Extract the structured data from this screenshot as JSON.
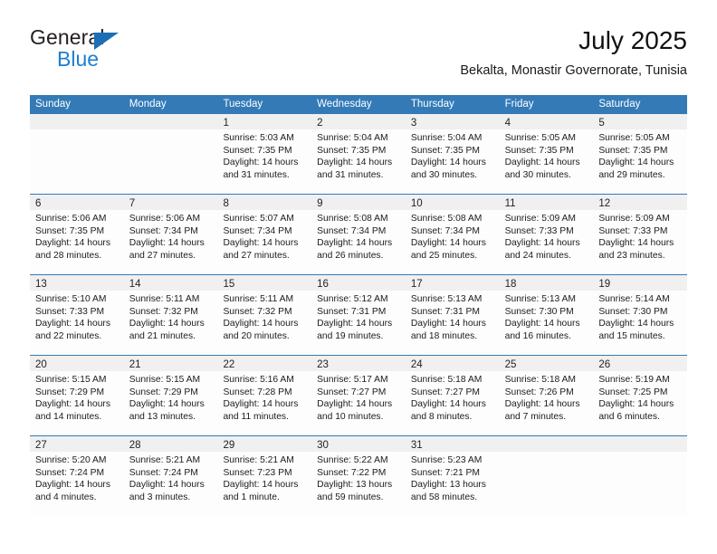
{
  "brand": {
    "name_part1": "General",
    "name_part2": "Blue",
    "accent_color": "#1c7fd3",
    "triangle_color": "#1c6fb5"
  },
  "header": {
    "title": "July 2025",
    "subtitle": "Bekalta, Monastir Governorate, Tunisia"
  },
  "theme": {
    "header_row_color": "#337ab7",
    "day_band_color": "#f0f0f0",
    "row_separator_color": "#337ab7"
  },
  "weekdays": [
    "Sunday",
    "Monday",
    "Tuesday",
    "Wednesday",
    "Thursday",
    "Friday",
    "Saturday"
  ],
  "weeks": [
    [
      {
        "day": "",
        "sunrise": "",
        "sunset": "",
        "daylight_line1": "",
        "daylight_line2": ""
      },
      {
        "day": "",
        "sunrise": "",
        "sunset": "",
        "daylight_line1": "",
        "daylight_line2": ""
      },
      {
        "day": "1",
        "sunrise": "Sunrise: 5:03 AM",
        "sunset": "Sunset: 7:35 PM",
        "daylight_line1": "Daylight: 14 hours",
        "daylight_line2": "and 31 minutes."
      },
      {
        "day": "2",
        "sunrise": "Sunrise: 5:04 AM",
        "sunset": "Sunset: 7:35 PM",
        "daylight_line1": "Daylight: 14 hours",
        "daylight_line2": "and 31 minutes."
      },
      {
        "day": "3",
        "sunrise": "Sunrise: 5:04 AM",
        "sunset": "Sunset: 7:35 PM",
        "daylight_line1": "Daylight: 14 hours",
        "daylight_line2": "and 30 minutes."
      },
      {
        "day": "4",
        "sunrise": "Sunrise: 5:05 AM",
        "sunset": "Sunset: 7:35 PM",
        "daylight_line1": "Daylight: 14 hours",
        "daylight_line2": "and 30 minutes."
      },
      {
        "day": "5",
        "sunrise": "Sunrise: 5:05 AM",
        "sunset": "Sunset: 7:35 PM",
        "daylight_line1": "Daylight: 14 hours",
        "daylight_line2": "and 29 minutes."
      }
    ],
    [
      {
        "day": "6",
        "sunrise": "Sunrise: 5:06 AM",
        "sunset": "Sunset: 7:35 PM",
        "daylight_line1": "Daylight: 14 hours",
        "daylight_line2": "and 28 minutes."
      },
      {
        "day": "7",
        "sunrise": "Sunrise: 5:06 AM",
        "sunset": "Sunset: 7:34 PM",
        "daylight_line1": "Daylight: 14 hours",
        "daylight_line2": "and 27 minutes."
      },
      {
        "day": "8",
        "sunrise": "Sunrise: 5:07 AM",
        "sunset": "Sunset: 7:34 PM",
        "daylight_line1": "Daylight: 14 hours",
        "daylight_line2": "and 27 minutes."
      },
      {
        "day": "9",
        "sunrise": "Sunrise: 5:08 AM",
        "sunset": "Sunset: 7:34 PM",
        "daylight_line1": "Daylight: 14 hours",
        "daylight_line2": "and 26 minutes."
      },
      {
        "day": "10",
        "sunrise": "Sunrise: 5:08 AM",
        "sunset": "Sunset: 7:34 PM",
        "daylight_line1": "Daylight: 14 hours",
        "daylight_line2": "and 25 minutes."
      },
      {
        "day": "11",
        "sunrise": "Sunrise: 5:09 AM",
        "sunset": "Sunset: 7:33 PM",
        "daylight_line1": "Daylight: 14 hours",
        "daylight_line2": "and 24 minutes."
      },
      {
        "day": "12",
        "sunrise": "Sunrise: 5:09 AM",
        "sunset": "Sunset: 7:33 PM",
        "daylight_line1": "Daylight: 14 hours",
        "daylight_line2": "and 23 minutes."
      }
    ],
    [
      {
        "day": "13",
        "sunrise": "Sunrise: 5:10 AM",
        "sunset": "Sunset: 7:33 PM",
        "daylight_line1": "Daylight: 14 hours",
        "daylight_line2": "and 22 minutes."
      },
      {
        "day": "14",
        "sunrise": "Sunrise: 5:11 AM",
        "sunset": "Sunset: 7:32 PM",
        "daylight_line1": "Daylight: 14 hours",
        "daylight_line2": "and 21 minutes."
      },
      {
        "day": "15",
        "sunrise": "Sunrise: 5:11 AM",
        "sunset": "Sunset: 7:32 PM",
        "daylight_line1": "Daylight: 14 hours",
        "daylight_line2": "and 20 minutes."
      },
      {
        "day": "16",
        "sunrise": "Sunrise: 5:12 AM",
        "sunset": "Sunset: 7:31 PM",
        "daylight_line1": "Daylight: 14 hours",
        "daylight_line2": "and 19 minutes."
      },
      {
        "day": "17",
        "sunrise": "Sunrise: 5:13 AM",
        "sunset": "Sunset: 7:31 PM",
        "daylight_line1": "Daylight: 14 hours",
        "daylight_line2": "and 18 minutes."
      },
      {
        "day": "18",
        "sunrise": "Sunrise: 5:13 AM",
        "sunset": "Sunset: 7:30 PM",
        "daylight_line1": "Daylight: 14 hours",
        "daylight_line2": "and 16 minutes."
      },
      {
        "day": "19",
        "sunrise": "Sunrise: 5:14 AM",
        "sunset": "Sunset: 7:30 PM",
        "daylight_line1": "Daylight: 14 hours",
        "daylight_line2": "and 15 minutes."
      }
    ],
    [
      {
        "day": "20",
        "sunrise": "Sunrise: 5:15 AM",
        "sunset": "Sunset: 7:29 PM",
        "daylight_line1": "Daylight: 14 hours",
        "daylight_line2": "and 14 minutes."
      },
      {
        "day": "21",
        "sunrise": "Sunrise: 5:15 AM",
        "sunset": "Sunset: 7:29 PM",
        "daylight_line1": "Daylight: 14 hours",
        "daylight_line2": "and 13 minutes."
      },
      {
        "day": "22",
        "sunrise": "Sunrise: 5:16 AM",
        "sunset": "Sunset: 7:28 PM",
        "daylight_line1": "Daylight: 14 hours",
        "daylight_line2": "and 11 minutes."
      },
      {
        "day": "23",
        "sunrise": "Sunrise: 5:17 AM",
        "sunset": "Sunset: 7:27 PM",
        "daylight_line1": "Daylight: 14 hours",
        "daylight_line2": "and 10 minutes."
      },
      {
        "day": "24",
        "sunrise": "Sunrise: 5:18 AM",
        "sunset": "Sunset: 7:27 PM",
        "daylight_line1": "Daylight: 14 hours",
        "daylight_line2": "and 8 minutes."
      },
      {
        "day": "25",
        "sunrise": "Sunrise: 5:18 AM",
        "sunset": "Sunset: 7:26 PM",
        "daylight_line1": "Daylight: 14 hours",
        "daylight_line2": "and 7 minutes."
      },
      {
        "day": "26",
        "sunrise": "Sunrise: 5:19 AM",
        "sunset": "Sunset: 7:25 PM",
        "daylight_line1": "Daylight: 14 hours",
        "daylight_line2": "and 6 minutes."
      }
    ],
    [
      {
        "day": "27",
        "sunrise": "Sunrise: 5:20 AM",
        "sunset": "Sunset: 7:24 PM",
        "daylight_line1": "Daylight: 14 hours",
        "daylight_line2": "and 4 minutes."
      },
      {
        "day": "28",
        "sunrise": "Sunrise: 5:21 AM",
        "sunset": "Sunset: 7:24 PM",
        "daylight_line1": "Daylight: 14 hours",
        "daylight_line2": "and 3 minutes."
      },
      {
        "day": "29",
        "sunrise": "Sunrise: 5:21 AM",
        "sunset": "Sunset: 7:23 PM",
        "daylight_line1": "Daylight: 14 hours",
        "daylight_line2": "and 1 minute."
      },
      {
        "day": "30",
        "sunrise": "Sunrise: 5:22 AM",
        "sunset": "Sunset: 7:22 PM",
        "daylight_line1": "Daylight: 13 hours",
        "daylight_line2": "and 59 minutes."
      },
      {
        "day": "31",
        "sunrise": "Sunrise: 5:23 AM",
        "sunset": "Sunset: 7:21 PM",
        "daylight_line1": "Daylight: 13 hours",
        "daylight_line2": "and 58 minutes."
      },
      {
        "day": "",
        "sunrise": "",
        "sunset": "",
        "daylight_line1": "",
        "daylight_line2": ""
      },
      {
        "day": "",
        "sunrise": "",
        "sunset": "",
        "daylight_line1": "",
        "daylight_line2": ""
      }
    ]
  ]
}
